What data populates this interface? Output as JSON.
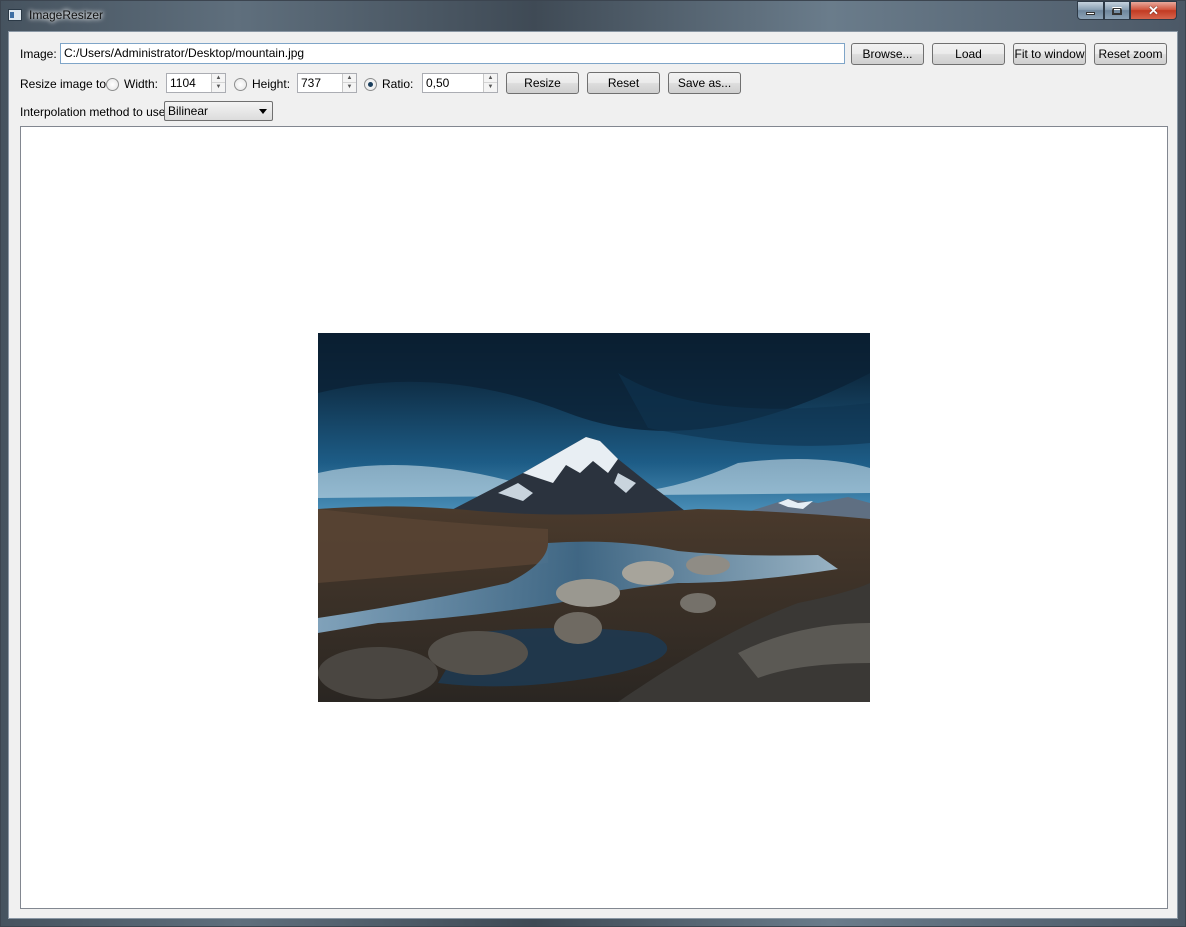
{
  "window": {
    "title": "ImageResizer"
  },
  "controls": {
    "minimize_icon": "minimize-icon",
    "maximize_icon": "maximize-icon",
    "close_icon": "close-icon"
  },
  "image_row": {
    "label": "Image:",
    "path_value": "C:/Users/Administrator/Desktop/mountain.jpg",
    "browse_label": "Browse...",
    "load_label": "Load",
    "fit_label": "Fit to window",
    "reset_zoom_label": "Reset zoom"
  },
  "resize_row": {
    "label": "Resize image to:",
    "width_label": "Width:",
    "width_value": "1104",
    "height_label": "Height:",
    "height_value": "737",
    "ratio_label": "Ratio:",
    "ratio_value": "0,50",
    "selected_mode": "ratio",
    "resize_label": "Resize",
    "reset_label": "Reset",
    "save_label": "Save as..."
  },
  "interp_row": {
    "label": "Interpolation method to use:",
    "selected": "Bilinear"
  },
  "preview": {
    "content": "mountain-landscape-photo"
  },
  "colors": {
    "client_bg": "#f0f0f0",
    "input_border_focus": "#7fa5c8",
    "close_red": "#c23a22"
  }
}
